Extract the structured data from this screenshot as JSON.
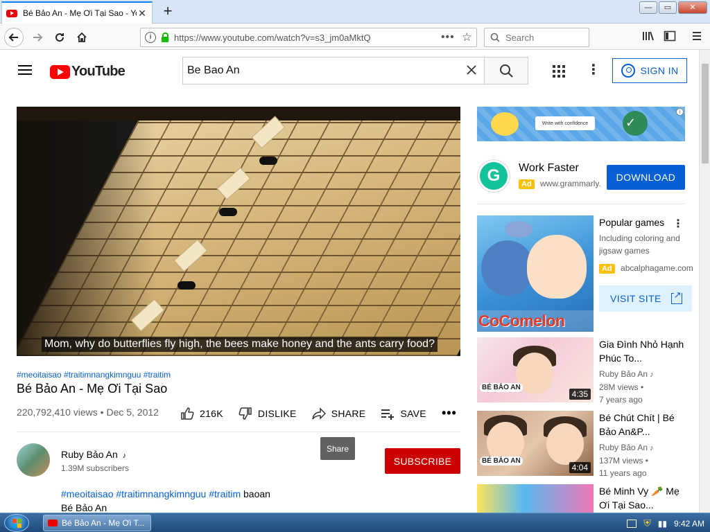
{
  "browser": {
    "tab_title": "Bé Bảo An - Mẹ Ơi Tại Sao - YouTube",
    "tab_close": "✕",
    "new_tab": "+",
    "window_buttons": [
      "—",
      "▭",
      "✕"
    ],
    "url": "https://www.youtube.com/watch?v=s3_jm0aMktQ",
    "page_actions": "•••",
    "bookmark_star": "☆",
    "search_placeholder": "Search"
  },
  "youtube": {
    "logo_text": "YouTube",
    "search_query": "Be Bao An",
    "signin_label": "SIGN IN"
  },
  "video": {
    "caption": "Mom, why do butterflies fly high, the bees make honey and the ants carry food?",
    "hashtags": "#meoitaisao #traitimnangkimnguu #traitim",
    "title": "Bé Bảo An - Mẹ Ơi Tại Sao",
    "views": "220,792,410 views",
    "date": "Dec 5, 2012",
    "likes": "216K",
    "dislike_label": "DISLIKE",
    "share_label": "SHARE",
    "save_label": "SAVE",
    "more": "•••",
    "tooltip": "Share"
  },
  "channel": {
    "name": "Ruby Bảo An",
    "music_note": "♪",
    "subscribers": "1.39M subscribers",
    "subscribe_label": "SUBSCRIBE"
  },
  "description": {
    "tags": "#meoitaisao #traitimnangkimnguu #traitim",
    "tags_plain": "baoan",
    "line2": "Bé Bảo An"
  },
  "sidebar": {
    "banner_card": "Write with confidence",
    "banner_info": "i",
    "ad1": {
      "title": "Work Faster",
      "badge": "Ad",
      "url": "www.grammarly.com",
      "cta": "DOWNLOAD",
      "logo_letter": "G"
    },
    "ad2": {
      "title": "Popular games",
      "description": "Including coloring and jigsaw games",
      "badge": "Ad",
      "url": "abcalphagame.com",
      "cta": "VISIT SITE",
      "logo_text": "CoComelon"
    },
    "recommendations": [
      {
        "title": "Gia Đình Nhỏ Hạnh Phúc To...",
        "channel": "Ruby Bảo An",
        "views": "28M views",
        "age": "7 years ago",
        "duration": "4:35",
        "chan_logo": "BÉ BẢO AN"
      },
      {
        "title": "Bé Chút Chít | Bé Bảo An&P...",
        "channel": "Ruby Bảo An",
        "views": "137M views",
        "age": "11 years ago",
        "duration": "4:04",
        "chan_logo": "BÉ BẢO AN"
      },
      {
        "title": "Bé Minh Vy 🥕 Mẹ Ơi Tại Sao...",
        "channel": "",
        "views": "",
        "age": "",
        "duration": "",
        "chan_logo": ""
      }
    ]
  },
  "taskbar": {
    "task_label": "Bé Bảo An - Mẹ Ơi T...",
    "time": "9:42 AM"
  }
}
